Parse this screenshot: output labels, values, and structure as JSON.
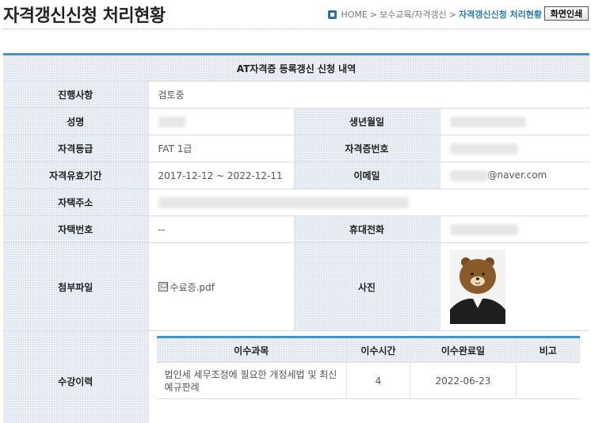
{
  "header": {
    "title": "자격갱신신청 처리현황",
    "breadcrumb": {
      "home": "HOME",
      "sep": ">",
      "level1": "보수교육/자격갱신",
      "current": "자격갱신신청 처리현황"
    },
    "print_label": "화면인쇄"
  },
  "form": {
    "caption": "AT자격증 등록갱신 신청 내역",
    "progress_label": "진행사항",
    "progress_value": "검토중",
    "name_label": "성명",
    "birth_label": "생년월일",
    "grade_label": "자격등급",
    "grade_value": "FAT 1급",
    "cert_no_label": "자격증번호",
    "validity_label": "자격유효기간",
    "validity_value": "2017-12-12 ~ 2022-12-11",
    "email_label": "이메일",
    "email_domain": "@naver.com",
    "address_label": "자택주소",
    "phone_label": "자택번호",
    "phone_value": "--",
    "mobile_label": "휴대전화",
    "attachment_label": "첨부파일",
    "attachment_file": "수료증.pdf",
    "photo_label": "사진",
    "history_label": "수강이력"
  },
  "history": {
    "headers": [
      "이수과목",
      "이수시간",
      "이수완료일",
      "비고"
    ],
    "rows": [
      {
        "course": "법인세 세무조정에 필요한 개정세법 및 최신 예규판례",
        "hours": "4",
        "date": "2022-06-23",
        "note": ""
      }
    ]
  },
  "colors": {
    "accent": "#3a98c8",
    "breadcrumb_current": "#2a7bb8",
    "header_cell_bg": "#eef2f6"
  }
}
